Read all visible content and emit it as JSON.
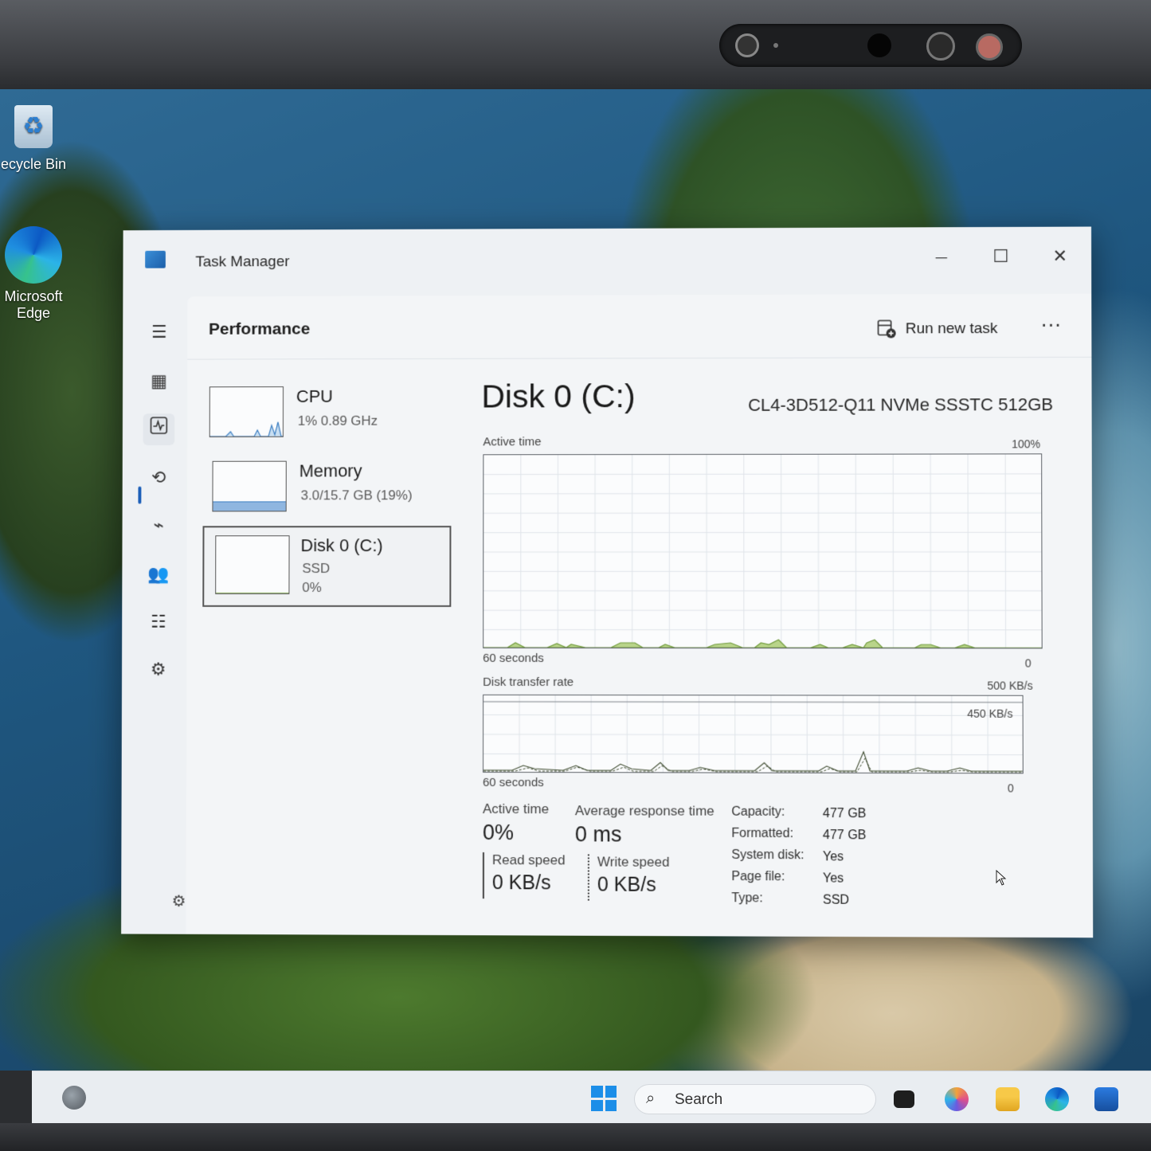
{
  "desktop": {
    "icons": [
      {
        "label": "ecycle Bin"
      },
      {
        "label_line1": "Microsoft",
        "label_line2": "Edge"
      }
    ]
  },
  "window": {
    "title": "Task Manager",
    "controls": {
      "minimize": "—",
      "maximize": "☐",
      "close": "✕"
    }
  },
  "header": {
    "title": "Performance",
    "run_new_task": "Run new task",
    "more": "···"
  },
  "resources": [
    {
      "name": "CPU",
      "detail": "1%  0.89 GHz"
    },
    {
      "name": "Memory",
      "detail": "3.0/15.7 GB (19%)",
      "fill_fraction": 0.19
    },
    {
      "name": "Disk 0 (C:)",
      "type": "SSD",
      "usage": "0%"
    }
  ],
  "detail": {
    "title": "Disk 0 (C:)",
    "model": "CL4-3D512-Q11 NVMe SSSTC 512GB",
    "active_time_graph": {
      "label": "Active time",
      "max": "100%",
      "time": "60 seconds",
      "min": "0"
    },
    "transfer_graph": {
      "label": "Disk transfer rate",
      "max": "500 KB/s",
      "line": "450 KB/s",
      "time": "60 seconds",
      "min": "0"
    },
    "stats": {
      "active_time_label": "Active time",
      "active_time_value": "0%",
      "avg_response_label": "Average response time",
      "avg_response_value": "0 ms",
      "read_label": "Read speed",
      "read_value": "0 KB/s",
      "write_label": "Write speed",
      "write_value": "0 KB/s"
    },
    "properties": [
      {
        "key": "Capacity:",
        "value": "477 GB"
      },
      {
        "key": "Formatted:",
        "value": "477 GB"
      },
      {
        "key": "System disk:",
        "value": "Yes"
      },
      {
        "key": "Page file:",
        "value": "Yes"
      },
      {
        "key": "Type:",
        "value": "SSD"
      }
    ]
  },
  "taskbar": {
    "search_placeholder": "Search"
  },
  "colors": {
    "accent": "#1c5fb8",
    "disk_graph_fill": "#b9d48a",
    "disk_graph_line": "#6f9a3a",
    "memory_fill": "#8fb6e0"
  }
}
